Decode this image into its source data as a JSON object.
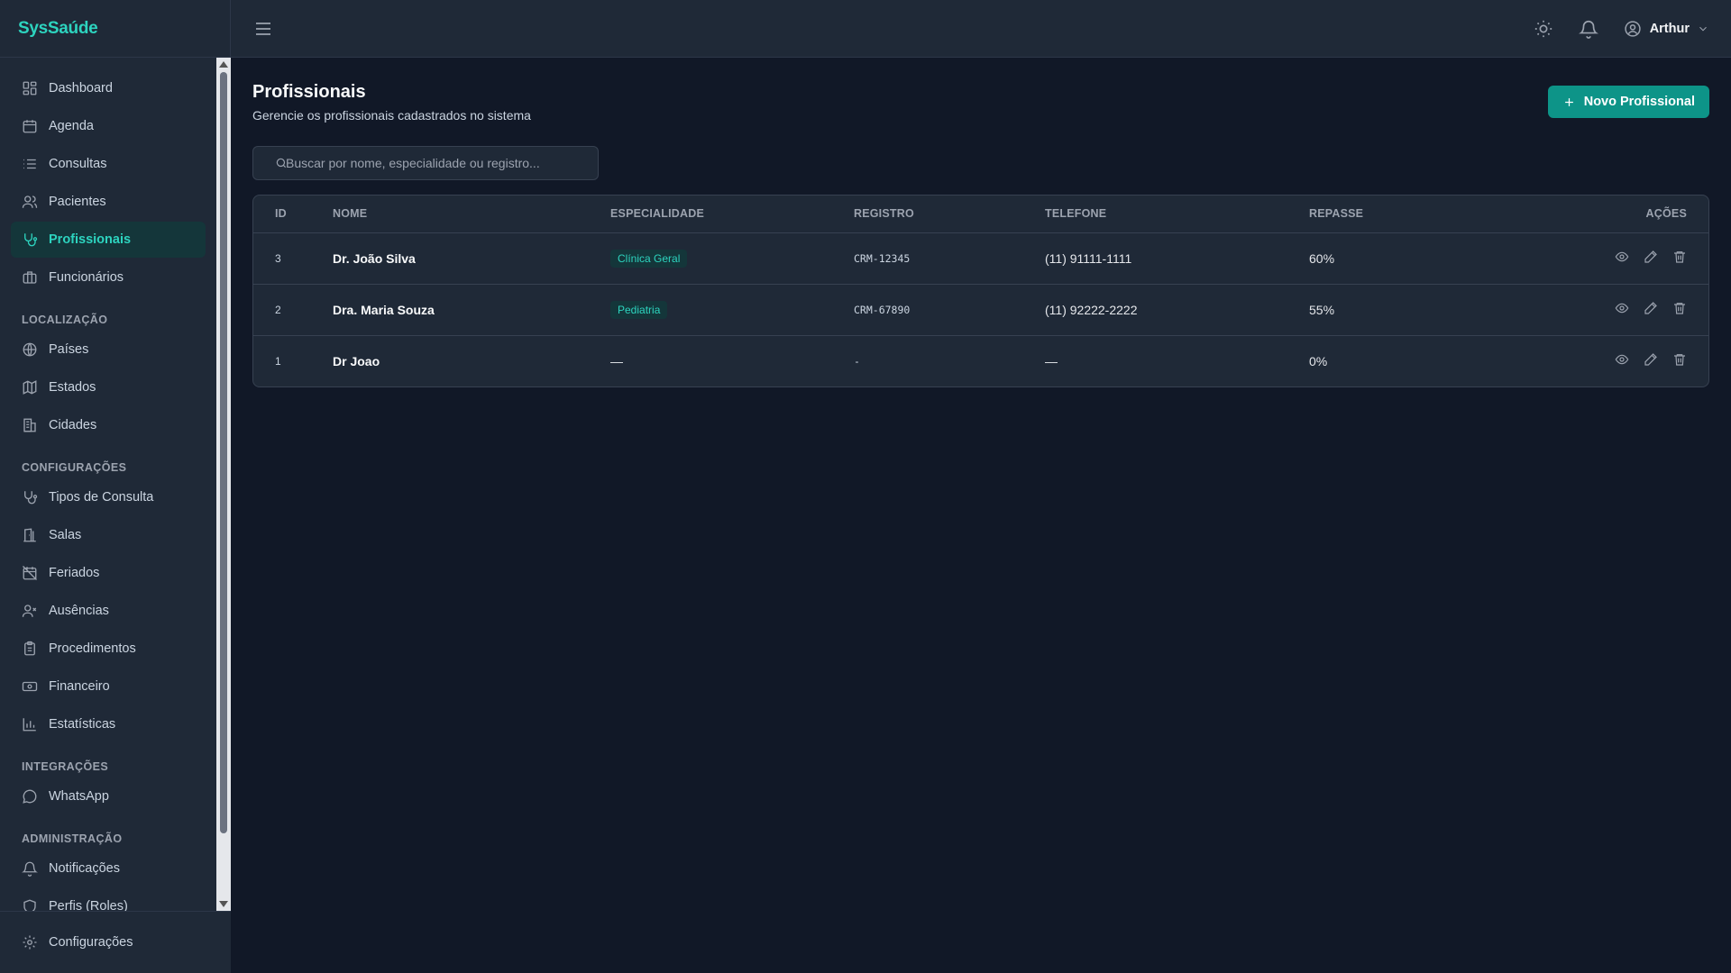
{
  "brand": "SysSaúde",
  "sidebar": {
    "items_top": [
      {
        "label": "Dashboard",
        "icon": "dashboard-icon"
      },
      {
        "label": "Agenda",
        "icon": "calendar-icon"
      },
      {
        "label": "Consultas",
        "icon": "list-icon"
      },
      {
        "label": "Pacientes",
        "icon": "users-icon"
      },
      {
        "label": "Profissionais",
        "icon": "stethoscope-icon",
        "active": true
      },
      {
        "label": "Funcionários",
        "icon": "briefcase-icon"
      }
    ],
    "sections": {
      "localizacao": "LOCALIZAÇÃO",
      "configuracoes": "CONFIGURAÇÕES",
      "integracoes": "INTEGRAÇÕES",
      "administracao": "ADMINISTRAÇÃO"
    },
    "localizacao": [
      "Países",
      "Estados",
      "Cidades"
    ],
    "configuracoes": [
      "Tipos de Consulta",
      "Salas",
      "Feriados",
      "Ausências",
      "Procedimentos",
      "Financeiro",
      "Estatísticas"
    ],
    "integracoes": [
      "WhatsApp"
    ],
    "administracao": [
      "Notificações",
      "Perfis (Roles)"
    ],
    "footer": "Configurações"
  },
  "header": {
    "user_name": "Arthur"
  },
  "page": {
    "title": "Profissionais",
    "subtitle": "Gerencie os profissionais cadastrados no sistema",
    "new_button": "Novo Profissional",
    "search_placeholder": "Buscar por nome, especialidade ou registro..."
  },
  "table": {
    "headers": {
      "id": "ID",
      "nome": "NOME",
      "especialidade": "ESPECIALIDADE",
      "registro": "REGISTRO",
      "telefone": "TELEFONE",
      "repasse": "REPASSE",
      "acoes": "AÇÕES"
    },
    "rows": [
      {
        "id": "3",
        "nome": "Dr. João Silva",
        "especialidade": "Clínica Geral",
        "registro": "CRM-12345",
        "telefone": "(11) 91111-1111",
        "repasse": "60%"
      },
      {
        "id": "2",
        "nome": "Dra. Maria Souza",
        "especialidade": "Pediatria",
        "registro": "CRM-67890",
        "telefone": "(11) 92222-2222",
        "repasse": "55%"
      },
      {
        "id": "1",
        "nome": "Dr Joao",
        "especialidade": "—",
        "registro": "-",
        "telefone": "—",
        "repasse": "0%"
      }
    ]
  }
}
